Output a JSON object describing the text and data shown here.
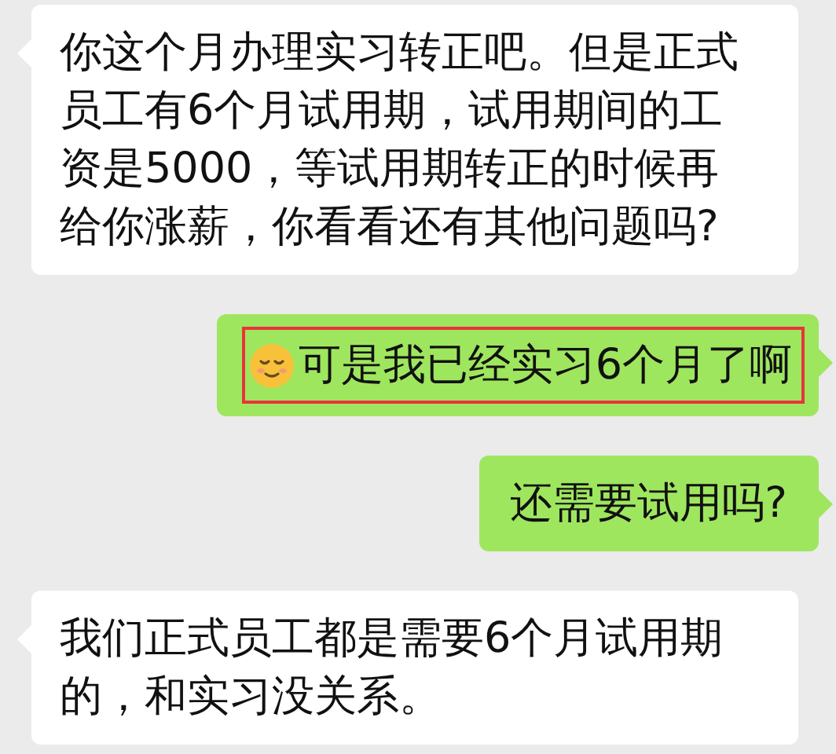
{
  "messages": [
    {
      "outgoing": false,
      "kind": "text",
      "lines": [
        "你这个月办理实习转正吧。但是正式",
        "员工有6个月试用期，试用期间的工",
        "资是5000，等试用期转正的时候再",
        "给你涨薪，你看看还有其他问题吗?"
      ],
      "highlighted": false
    },
    {
      "outgoing": true,
      "kind": "emoji",
      "lines": [
        "可是我已经实习6个月了啊"
      ],
      "highlighted": true
    },
    {
      "outgoing": true,
      "kind": "text",
      "lines": [
        "还需要试用吗?"
      ],
      "highlighted": false
    },
    {
      "outgoing": false,
      "kind": "text",
      "lines": [
        "我们正式员工都是需要6个月试用期",
        "的，和实习没关系。"
      ],
      "highlighted": false
    }
  ]
}
